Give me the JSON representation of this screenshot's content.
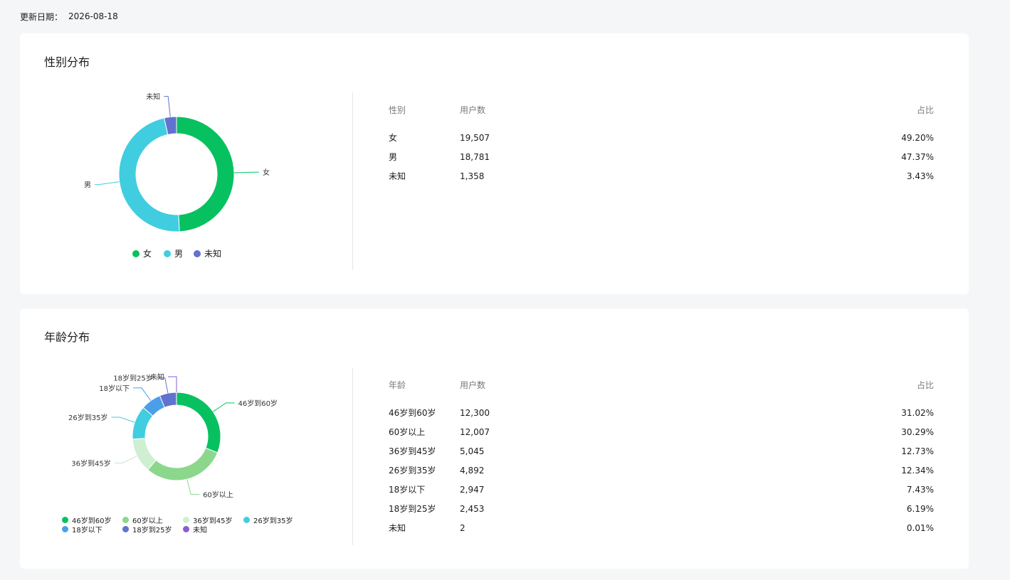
{
  "update": {
    "label": "更新日期：",
    "date": "2026-08-18"
  },
  "gender": {
    "title": "性别分布",
    "table": {
      "headers": [
        "性别",
        "用户数",
        "占比"
      ],
      "rows": [
        {
          "label": "女",
          "count": "19,507",
          "pct": "49.20%"
        },
        {
          "label": "男",
          "count": "18,781",
          "pct": "47.37%"
        },
        {
          "label": "未知",
          "count": "1,358",
          "pct": "3.43%"
        }
      ]
    },
    "legend": [
      "女",
      "男",
      "未知"
    ],
    "colors": [
      "#07c160",
      "#40cde0",
      "#6172cf"
    ],
    "chart_data": {
      "type": "pie",
      "categories": [
        "女",
        "男",
        "未知"
      ],
      "values": [
        49.2,
        47.37,
        3.43
      ],
      "counts": [
        19507,
        18781,
        1358
      ],
      "donut": true,
      "legend_position": "bottom"
    }
  },
  "age": {
    "title": "年龄分布",
    "table": {
      "headers": [
        "年龄",
        "用户数",
        "占比"
      ],
      "rows": [
        {
          "label": "46岁到60岁",
          "count": "12,300",
          "pct": "31.02%"
        },
        {
          "label": "60岁以上",
          "count": "12,007",
          "pct": "30.29%"
        },
        {
          "label": "36岁到45岁",
          "count": "5,045",
          "pct": "12.73%"
        },
        {
          "label": "26岁到35岁",
          "count": "4,892",
          "pct": "12.34%"
        },
        {
          "label": "18岁以下",
          "count": "2,947",
          "pct": "7.43%"
        },
        {
          "label": "18岁到25岁",
          "count": "2,453",
          "pct": "6.19%"
        },
        {
          "label": "未知",
          "count": "2",
          "pct": "0.01%"
        }
      ]
    },
    "legend": [
      "46岁到60岁",
      "60岁以上",
      "36岁到45岁",
      "26岁到35岁",
      "18岁以下",
      "18岁到25岁",
      "未知"
    ],
    "colors": [
      "#07c160",
      "#8bd88c",
      "#cfeed2",
      "#40cde0",
      "#4b9fe8",
      "#6172cf",
      "#8a5cd1"
    ],
    "chart_data": {
      "type": "pie",
      "categories": [
        "46岁到60岁",
        "60岁以上",
        "36岁到45岁",
        "26岁到35岁",
        "18岁以下",
        "18岁到25岁",
        "未知"
      ],
      "values": [
        31.02,
        30.29,
        12.73,
        12.34,
        7.43,
        6.19,
        0.01
      ],
      "counts": [
        12300,
        12007,
        5045,
        4892,
        2947,
        2453,
        2
      ],
      "donut": true,
      "legend_position": "bottom"
    }
  }
}
